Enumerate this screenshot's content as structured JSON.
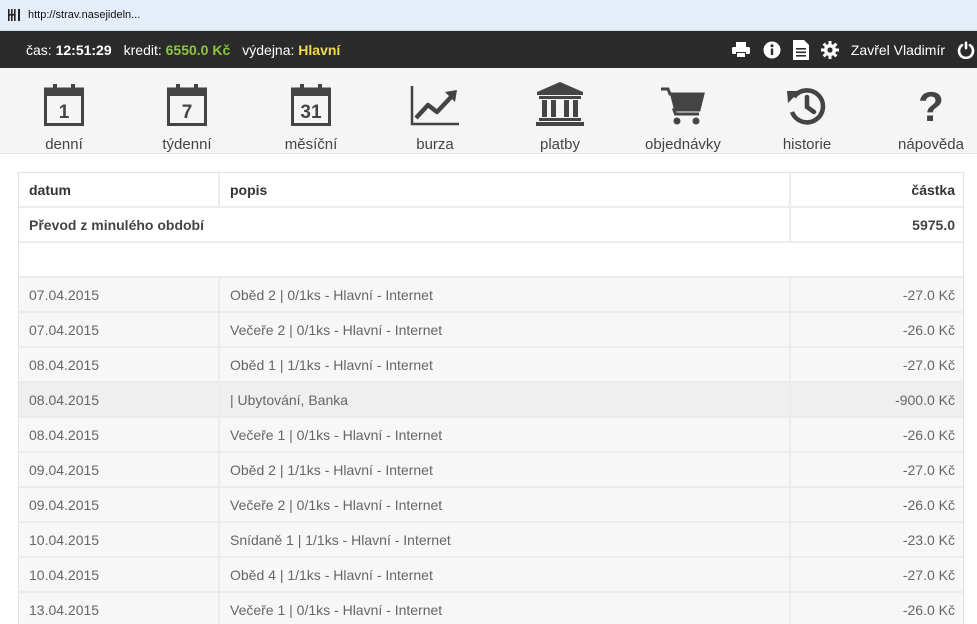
{
  "browser": {
    "url": "http://strav.nasejideln..."
  },
  "status_bar": {
    "time_label": "čas:",
    "time_value": "12:51:29",
    "credit_label": "kredit:",
    "credit_value": "6550.0 Kč",
    "canteen_label": "výdejna:",
    "canteen_value": "Hlavní",
    "user_name": "Zavřel Vladimír",
    "icons": [
      "print-icon",
      "info-icon",
      "document-icon",
      "gear-icon",
      "power-icon"
    ],
    "colors": {
      "credit": "#8cc63f",
      "canteen": "#f2d94e",
      "background": "#2b2b2b"
    }
  },
  "nav": {
    "items": [
      {
        "label": "denní",
        "icon": "calendar-day-icon",
        "icon_text": "1"
      },
      {
        "label": "týdenní",
        "icon": "calendar-week-icon",
        "icon_text": "7"
      },
      {
        "label": "měsíční",
        "icon": "calendar-month-icon",
        "icon_text": "31"
      },
      {
        "label": "burza",
        "icon": "line-chart-icon"
      },
      {
        "label": "platby",
        "icon": "bank-icon"
      },
      {
        "label": "objednávky",
        "icon": "cart-icon"
      },
      {
        "label": "historie",
        "icon": "history-icon"
      },
      {
        "label": "nápověda",
        "icon": "question-icon",
        "icon_text": "?"
      }
    ]
  },
  "table": {
    "headers": {
      "date": "datum",
      "description": "popis",
      "amount": "částka"
    },
    "carry_over": {
      "label": "Převod z minulého období",
      "amount": "5975.0"
    },
    "rows": [
      {
        "date": "07.04.2015",
        "description": "Oběd 2 | 0/1ks - Hlavní - Internet",
        "amount": "-27.0 Kč"
      },
      {
        "date": "07.04.2015",
        "description": "Večeře 2 | 0/1ks - Hlavní - Internet",
        "amount": "-26.0 Kč"
      },
      {
        "date": "08.04.2015",
        "description": "Oběd 1 | 1/1ks - Hlavní - Internet",
        "amount": "-27.0 Kč"
      },
      {
        "date": "08.04.2015",
        "description": "| Ubytování, Banka",
        "amount": "-900.0 Kč"
      },
      {
        "date": "08.04.2015",
        "description": "Večeře 1 | 0/1ks - Hlavní - Internet",
        "amount": "-26.0 Kč"
      },
      {
        "date": "09.04.2015",
        "description": "Oběd 2 | 1/1ks - Hlavní - Internet",
        "amount": "-27.0 Kč"
      },
      {
        "date": "09.04.2015",
        "description": "Večeře 2 | 0/1ks - Hlavní - Internet",
        "amount": "-26.0 Kč"
      },
      {
        "date": "10.04.2015",
        "description": "Snídaně 1 | 1/1ks - Hlavní - Internet",
        "amount": "-23.0 Kč"
      },
      {
        "date": "10.04.2015",
        "description": "Oběd 4 | 1/1ks - Hlavní - Internet",
        "amount": "-27.0 Kč"
      },
      {
        "date": "13.04.2015",
        "description": "Večeře 1 | 0/1ks - Hlavní - Internet",
        "amount": "-26.0 Kč"
      }
    ]
  }
}
